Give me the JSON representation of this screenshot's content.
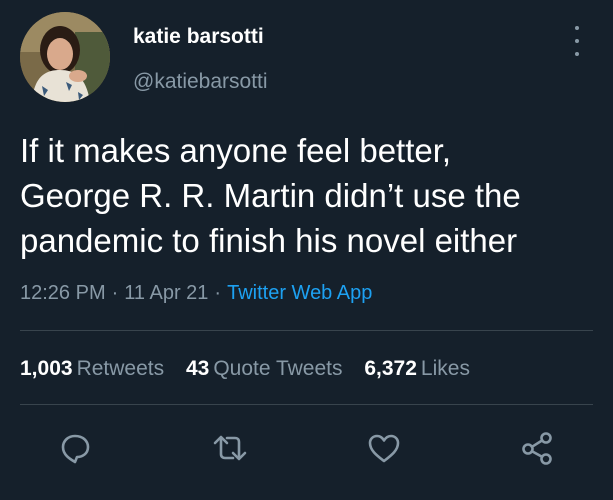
{
  "author": {
    "display_name": "katie barsotti",
    "handle": "@katiebarsotti",
    "avatar_icon": "profile-photo"
  },
  "tweet": {
    "lines": [
      "If it makes anyone feel better,",
      "George R. R. Martin didn’t use the",
      "pandemic to finish his novel either"
    ]
  },
  "meta": {
    "time": "12:26 PM",
    "separator": "·",
    "date": "11 Apr 21",
    "source": "Twitter Web App"
  },
  "stats": {
    "retweets_count": "1,003",
    "retweets_label": "Retweets",
    "quotes_count": "43",
    "quotes_label": "Quote Tweets",
    "likes_count": "6,372",
    "likes_label": "Likes"
  },
  "actions": {
    "icons": [
      "reply-icon",
      "retweet-icon",
      "like-icon",
      "share-icon"
    ]
  },
  "colors": {
    "background": "#15202b",
    "primary_text": "#ffffff",
    "secondary_text": "#8899a6",
    "accent": "#1da1f2",
    "divider": "#38444d"
  }
}
